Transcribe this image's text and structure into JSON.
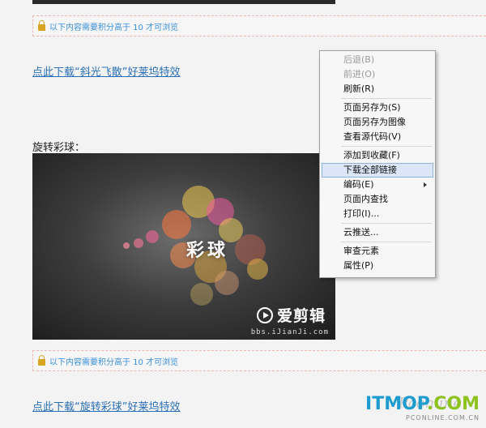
{
  "notices": {
    "text": "以下内容需要积分高于 10 才可浏览"
  },
  "links": {
    "first": "点此下载“斜光飞散”好莱坞特效",
    "second": "点此下载“旋转彩球”好莱坞特效"
  },
  "preview": {
    "caption": "旋转彩球：",
    "title": "彩球",
    "brand_name": "爱剪辑",
    "brand_url": "bbs.iJianJi.com"
  },
  "context_menu": {
    "items": [
      {
        "label": "后退(B)",
        "disabled": true
      },
      {
        "label": "前进(O)",
        "disabled": true
      },
      {
        "label": "刷新(R)",
        "disabled": false
      },
      {
        "label": "页面另存为(S)",
        "disabled": false
      },
      {
        "label": "页面另存为图像",
        "disabled": false
      },
      {
        "label": "查看源代码(V)",
        "disabled": false
      },
      {
        "label": "添加到收藏(F)",
        "disabled": false
      },
      {
        "label": "下载全部链接",
        "disabled": false,
        "highlighted": true
      },
      {
        "label": "编码(E)",
        "disabled": false,
        "submenu": true
      },
      {
        "label": "页面内查找",
        "disabled": false
      },
      {
        "label": "打印(I)...",
        "disabled": false
      },
      {
        "label": "云推送...",
        "disabled": false
      },
      {
        "label": "审查元素",
        "disabled": false
      },
      {
        "label": "属性(P)",
        "disabled": false
      }
    ]
  },
  "watermark": {
    "pconline": "Pconline",
    "itmop": "ITMOP",
    "itmop_suffix": ".COM",
    "sub": "PCONLINE.COM.CN"
  },
  "colors": {
    "link": "#2a6fb5",
    "notice_text": "#3a8fd8",
    "menu_highlight": "#dbe7f8",
    "watermark_blue": "#1f9ccf",
    "watermark_green": "#8dc21f"
  }
}
